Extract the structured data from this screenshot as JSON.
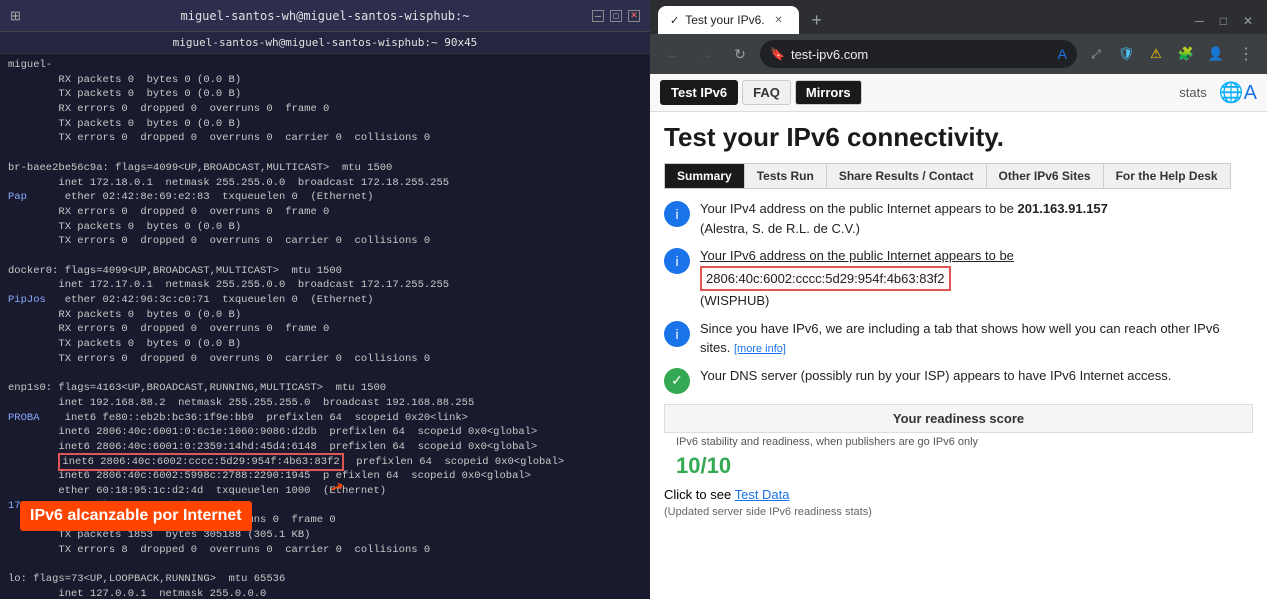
{
  "terminal": {
    "titlebar": "miguel-santos-wh@miguel-santos-wisphub:~",
    "subtitle": "miguel-santos-wh@miguel-santos-wisphub:~ 90x45",
    "lines": [
      "miguel-",
      "        RX packets 0  bytes 0 (0.0 B)",
      "        TX packets 0  bytes 0 (0.0 B)",
      "        RX errors 0  dropped 0  overruns 0  frame 0",
      "        TX packets 0  bytes 0 (0.0 B)",
      "        TX errors 0  dropped 0  overruns 0  carrier 0  collisions 0",
      "",
      "br-baee2be56c9a: flags=4099<UP,BROADCAST,MULTICAST>  mtu 1500",
      "        inet 172.18.0.1  netmask 255.255.0.0  broadcast 172.18.255.255",
      "Pap      ether 02:42:8e:69:e2:83  txqueuelen 0  (Ethernet)",
      "        RX errors 0  dropped 0  overruns 0  frame 0",
      "        TX packets 0  bytes 0 (0.0 B)",
      "        TX errors 0  dropped 0  overruns 0  carrier 0  collisions 0",
      "",
      "docker0: flags=4099<UP,BROADCAST,MULTICAST>  mtu 1500",
      "        inet 172.17.0.1  netmask 255.255.0.0  broadcast 172.17.255.255",
      "PipJos   ether 02:42:96:3c:c0:71  txqueuelen 0  (Ethernet)",
      "        RX packets 0  bytes 0 (0.0 B)",
      "        RX errors 0  dropped 0  overruns 0  frame 0",
      "        TX packets 0  bytes 0 (0.0 B)",
      "        TX errors 0  dropped 0  overruns 0  carrier 0  collisions 0",
      "",
      "enp1s0: flags=4163<UP,BROADCAST,RUNNING,MULTICAST>  mtu 1500",
      "        inet 192.168.88.2  netmask 255.255.255.0  broadcast 192.168.88.255",
      "PROBA    inet6 fe80::eb2b:bc36:1f9e:bb9  prefixlen 64  scopeid 0x20<link>",
      "        inet6 2806:40c:6001:0:6c1e:1060:9086:d2db  prefixlen 64  scopeid 0x0<global>",
      "        inet6 2806:40c:6001:0:2359:14hd:45d4:6148  prefixlen 64  scopeid 0x0<global>",
      "        inet6 2806:40c:6002:cccc:5d29:954f:4b63:83f2  prefixlen 64  scopeid 0x0<global>",
      "        inet6 2806:40c:6002:5998c:2788:2290:1945  p efixlen 64  scopeid 0x0<global>",
      "        ether 60:18:95:1c:d2:4d  txqueuelen 1000  (Ethernet)",
      "17-      RX packets 1045157 (1.0 MB)",
      "        RX errors 0  dropped 48  overruns 0  frame 0",
      "        TX packets 1853  bytes 305188 (305.1 KB)",
      "        TX errors 8  dropped 0  overruns 0  carrier 0  collisions 0",
      "",
      "lo: flags=73<UP,LOOPBACK,RUNNING>  mtu 65536",
      "        inet 127.0.0.1  netmask 255.0.0.0"
    ],
    "highlighted_ip": "inet6 2806:40c:6002:cccc:5d29:954f:4b63:83f2",
    "annotation": "IPv6 alcanzable por Internet"
  },
  "browser": {
    "tab_title": "Test your IPv6.",
    "url": "test-ipv6.com",
    "nav_tabs": [
      "Test IPv6",
      "FAQ",
      "Mirrors"
    ],
    "active_nav_tab": "Test IPv6",
    "mirrors_tab": "Mirrors",
    "stats_label": "stats",
    "main_heading": "Test your IPv6 connectivity.",
    "content_tabs": [
      "Summary",
      "Tests Run",
      "Share Results / Contact",
      "Other IPv6 Sites",
      "For the Help Desk"
    ],
    "active_content_tab": "Summary",
    "cards": [
      {
        "type": "info",
        "text": "Your IPv4 address on the public Internet appears to be 201.163.91.157 (Alestra, S. de R.L. de C.V.)"
      },
      {
        "type": "info",
        "text": "Your IPv6 address on the public Internet appears to be",
        "ip": "2806:40c:6002:cccc:5d29:954f:4b63:83f2",
        "host": "(WISPHUB)"
      },
      {
        "type": "info",
        "text": "Since you have IPv6, we are including a tab that shows how well you can reach other IPv6 sites.",
        "more_info": "more info"
      },
      {
        "type": "check",
        "text": "Your DNS server (possibly run by your ISP) appears to have IPv6 Internet access."
      }
    ],
    "readiness_title": "Your readiness score",
    "readiness_detail": "IPv6 stability and readiness, when publishers are go IPv6 only",
    "score": "10/10",
    "test_data_label": "Click to see",
    "test_data_link": "Test Data",
    "bottom_note": "(Updated server side IPv6 readiness stats)"
  }
}
